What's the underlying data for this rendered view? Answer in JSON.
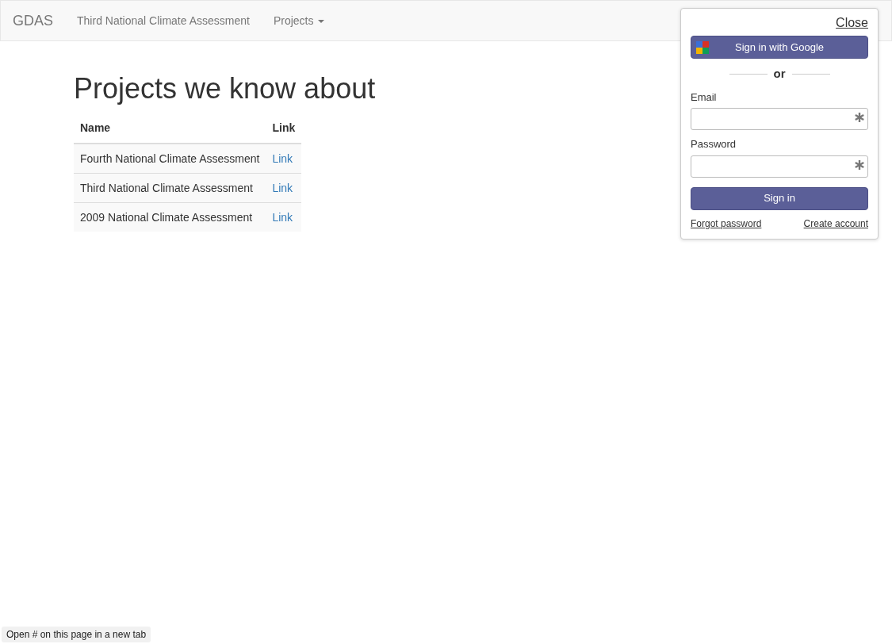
{
  "navbar": {
    "brand": "GDAS",
    "items": [
      {
        "label": "Third National Climate Assessment",
        "kind": "link"
      },
      {
        "label": "Projects",
        "kind": "dropdown"
      }
    ]
  },
  "heading": "Projects we know about",
  "table": {
    "columns": [
      "Name",
      "Link"
    ],
    "rows": [
      {
        "name": "Fourth National Climate Assessment",
        "link": "Link"
      },
      {
        "name": "Third National Climate Assessment",
        "link": "Link"
      },
      {
        "name": "2009 National Climate Assessment",
        "link": "Link"
      }
    ]
  },
  "login": {
    "close": "Close",
    "google_button": "Sign in with Google",
    "divider": "or",
    "fields": [
      {
        "label": "Email",
        "required": true
      },
      {
        "label": "Password",
        "required": true
      }
    ],
    "submit": "Sign in",
    "links": [
      "Forgot password",
      "Create account"
    ]
  },
  "status_bar": "Open # on this page in a new tab"
}
